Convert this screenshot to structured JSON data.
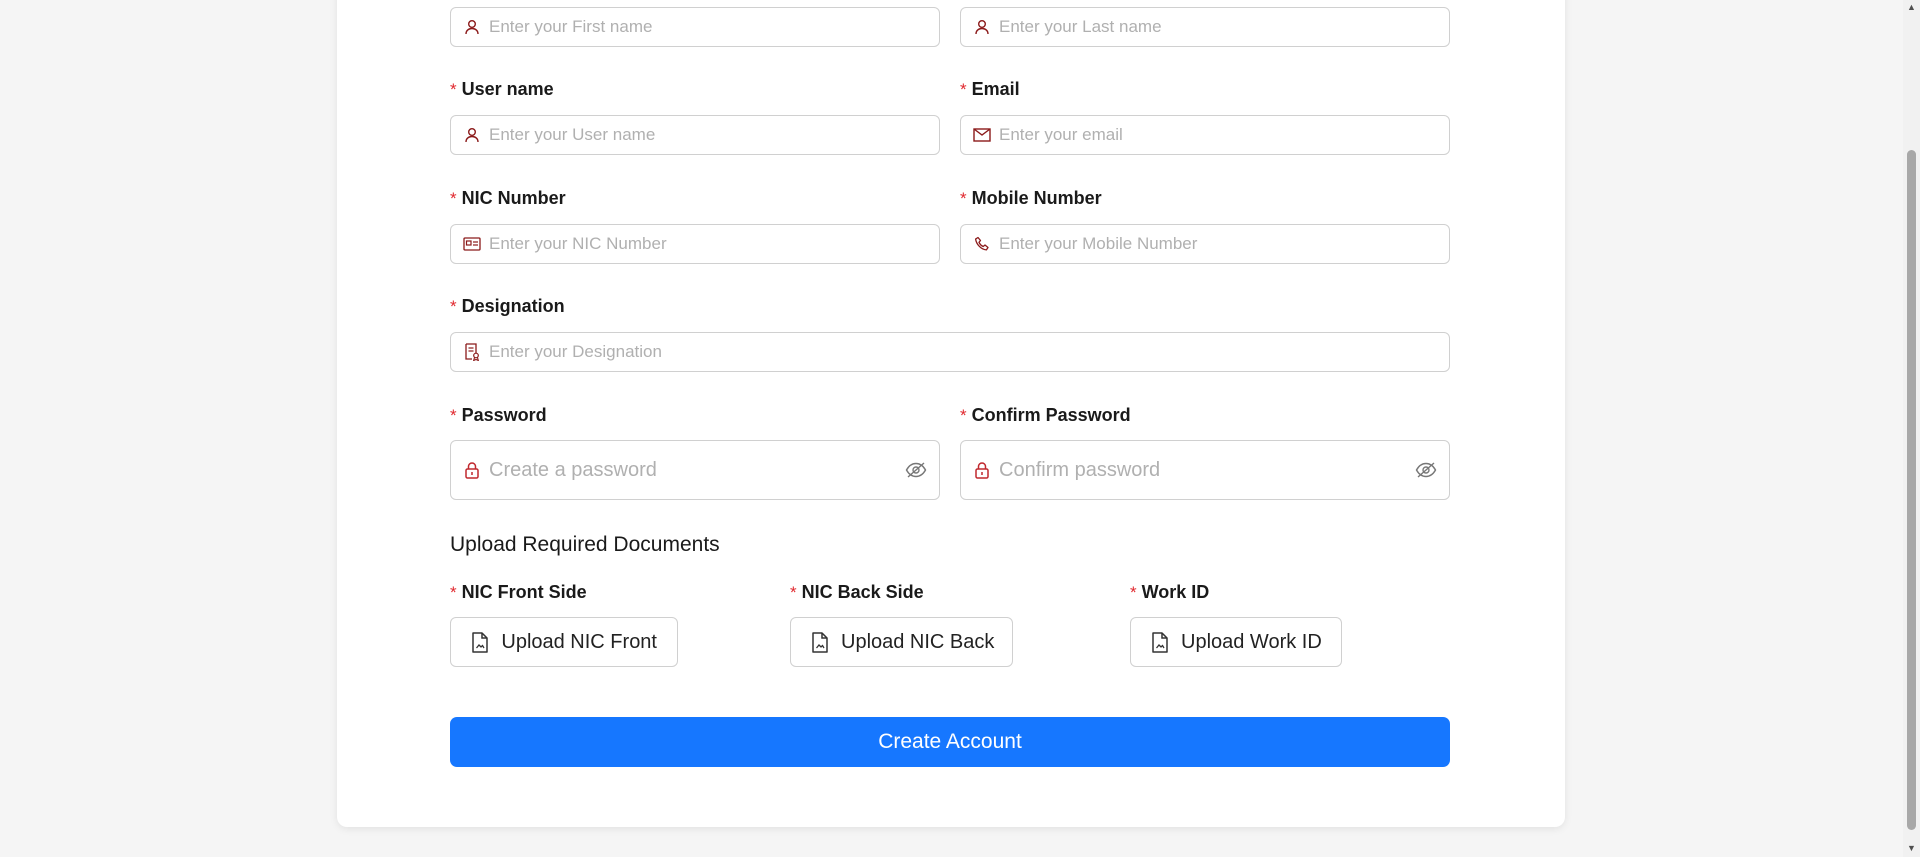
{
  "form": {
    "first_name": {
      "placeholder": "Enter your First name"
    },
    "last_name": {
      "placeholder": "Enter your Last name"
    },
    "username": {
      "label": "User name",
      "placeholder": "Enter your User name"
    },
    "email": {
      "label": "Email",
      "placeholder": "Enter your email"
    },
    "nic": {
      "label": "NIC Number",
      "placeholder": "Enter your NIC Number"
    },
    "mobile": {
      "label": "Mobile Number",
      "placeholder": "Enter your Mobile Number"
    },
    "designation": {
      "label": "Designation",
      "placeholder": "Enter your Designation"
    },
    "password": {
      "label": "Password",
      "placeholder": "Create a password"
    },
    "confirm_password": {
      "label": "Confirm Password",
      "placeholder": "Confirm password"
    },
    "required_mark": "*"
  },
  "uploads": {
    "section_title": "Upload Required Documents",
    "nic_front": {
      "label": "NIC Front Side",
      "button": "Upload NIC Front"
    },
    "nic_back": {
      "label": "NIC Back Side",
      "button": "Upload NIC Back"
    },
    "work_id": {
      "label": "Work ID",
      "button": "Upload Work ID"
    }
  },
  "submit": {
    "label": "Create Account"
  },
  "colors": {
    "accent": "#1677ff",
    "icon": "#8b1a1a",
    "required": "#e0282e"
  }
}
